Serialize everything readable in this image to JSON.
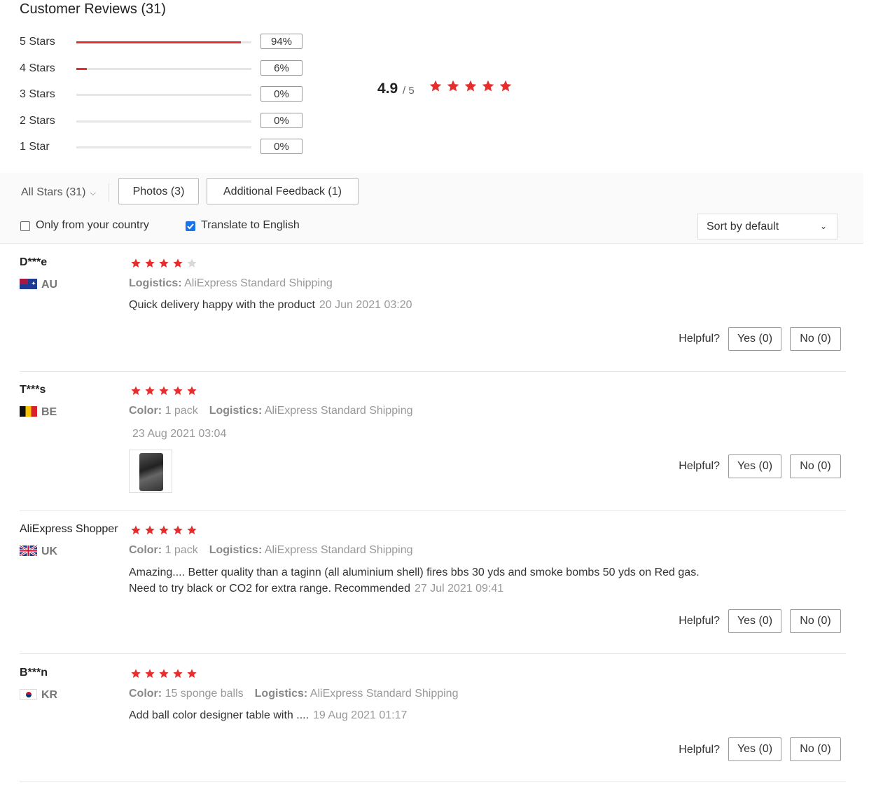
{
  "header": {
    "title": "Customer Reviews (31)"
  },
  "distribution": [
    {
      "label": "5 Stars",
      "percent": "94%",
      "fill": 94
    },
    {
      "label": "4 Stars",
      "percent": "6%",
      "fill": 6
    },
    {
      "label": "3 Stars",
      "percent": "0%",
      "fill": 0
    },
    {
      "label": "2 Stars",
      "percent": "0%",
      "fill": 0
    },
    {
      "label": "1 Star",
      "percent": "0%",
      "fill": 0
    }
  ],
  "summary": {
    "average": "4.9",
    "max": "/ 5",
    "stars": 5
  },
  "filters": {
    "all_stars": "All Stars (31)",
    "photos": "Photos (3)",
    "additional": "Additional Feedback (1)",
    "only_country": "Only from your country",
    "only_country_checked": false,
    "translate": "Translate to English",
    "translate_checked": true,
    "sort": "Sort by default"
  },
  "colors": {
    "star": "#e62e2e",
    "star_empty": "#d9d9d9",
    "bar": "#e62e2e",
    "checkbox": "#1a73e8"
  },
  "reviews": [
    {
      "user": "D***e",
      "country": "AU",
      "rating": 4,
      "logistics_label": "Logistics:",
      "logistics": "AliExpress Standard Shipping",
      "text": "Quick delivery happy with the product",
      "date": "20 Jun 2021 03:20",
      "helpful_label": "Helpful?",
      "yes": "Yes (0)",
      "no": "No (0)"
    },
    {
      "user": "T***s",
      "country": "BE",
      "rating": 5,
      "color_label": "Color:",
      "color": "1 pack",
      "logistics_label": "Logistics:",
      "logistics": "AliExpress Standard Shipping",
      "date": "23 Aug 2021 03:04",
      "helpful_label": "Helpful?",
      "yes": "Yes (0)",
      "no": "No (0)"
    },
    {
      "user": "AliExpress Shopper",
      "country": "UK",
      "rating": 5,
      "color_label": "Color:",
      "color": "1 pack",
      "logistics_label": "Logistics:",
      "logistics": "AliExpress Standard Shipping",
      "text_line1": "Amazing.... Better quality than a taginn (all aluminium shell) fires bbs 30 yds and smoke bombs 50 yds on Red gas.",
      "text_line2": "Need to try black or CO2 for extra range. Recommended",
      "date": "27 Jul 2021 09:41",
      "helpful_label": "Helpful?",
      "yes": "Yes (0)",
      "no": "No (0)"
    },
    {
      "user": "B***n",
      "country": "KR",
      "rating": 5,
      "color_label": "Color:",
      "color": "15 sponge balls",
      "logistics_label": "Logistics:",
      "logistics": "AliExpress Standard Shipping",
      "text": "Add ball color designer table with ....",
      "date": "19 Aug 2021 01:17",
      "helpful_label": "Helpful?",
      "yes": "Yes (0)",
      "no": "No (0)"
    }
  ]
}
